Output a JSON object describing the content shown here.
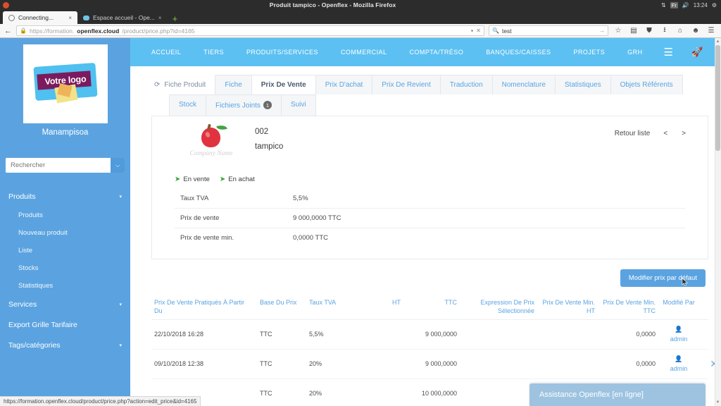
{
  "os": {
    "window_title": "Produit tampico - Openflex - Mozilla Firefox",
    "keyboard_layout": "Fr",
    "clock": "13:24",
    "network_icon": "network-icon",
    "volume_icon": "volume-icon",
    "settings_icon": "gear-icon"
  },
  "browser": {
    "tabs": [
      {
        "label": "Connecting...",
        "close": "×",
        "active": true
      },
      {
        "label": "Espace accueil - Ope...",
        "close": "×",
        "active": false
      }
    ],
    "new_tab": "+",
    "back_icon": "←",
    "url": {
      "scheme": "https://formation.",
      "host": "openflex.cloud",
      "path": "/product/price.php?id=4165",
      "lock_icon": "🔒"
    },
    "search": {
      "value": "test",
      "icon": "🔍",
      "go": "→"
    },
    "toolbar_icons": [
      "star-icon",
      "pocket-icon",
      "shield-icon",
      "download-icon",
      "home-icon",
      "account-icon",
      "menu-icon"
    ]
  },
  "sidebar": {
    "logo_text": "Votre logo",
    "company": "Manampisoa",
    "search_placeholder": "Rechercher",
    "dropdown_caret": "⌵",
    "groups": [
      {
        "label": "Produits",
        "caret": "▾",
        "type": "group"
      },
      {
        "label": "Produits",
        "type": "sub"
      },
      {
        "label": "Nouveau produit",
        "type": "sub"
      },
      {
        "label": "Liste",
        "type": "sub"
      },
      {
        "label": "Stocks",
        "type": "sub"
      },
      {
        "label": "Statistiques",
        "type": "sub"
      },
      {
        "label": "Services",
        "caret": "▾",
        "type": "group"
      },
      {
        "label": "Export Grille Tarifaire",
        "type": "item"
      },
      {
        "label": "Tags/catégories",
        "caret": "▾",
        "type": "group"
      }
    ]
  },
  "topnav": {
    "items": [
      "ACCUEIL",
      "TIERS",
      "PRODUITS/SERVICES",
      "COMMERCIAL",
      "COMPTA/TRÉSO",
      "BANQUES/CAISSES",
      "PROJETS",
      "GRH"
    ],
    "burger": "☰",
    "right_icons": [
      "rocket-icon",
      "user-icon",
      "printer-icon",
      "power-icon"
    ]
  },
  "product_tabs": {
    "fiche_produit": "Fiche Produit",
    "refresh_icon": "refresh-icon",
    "row1": [
      {
        "label": "Fiche",
        "active": false
      },
      {
        "label": "Prix De Vente",
        "active": true
      },
      {
        "label": "Prix D'achat",
        "active": false
      },
      {
        "label": "Prix De Revient",
        "active": false
      },
      {
        "label": "Traduction",
        "active": false
      },
      {
        "label": "Nomenclature",
        "active": false
      },
      {
        "label": "Statistiques",
        "active": false
      },
      {
        "label": "Objets Référents",
        "active": false
      }
    ],
    "row2": [
      {
        "label": "Stock",
        "active": false,
        "badge": ""
      },
      {
        "label": "Fichiers Joints",
        "active": false,
        "badge": "1"
      },
      {
        "label": "Suivi",
        "active": false,
        "badge": ""
      }
    ]
  },
  "product": {
    "code": "002",
    "name": "tampico",
    "logo_caption": "Company Name",
    "retour_liste": "Retour liste",
    "prev": "<",
    "next": ">",
    "flags": [
      {
        "label": "En vente",
        "icon": "check-flag-icon"
      },
      {
        "label": "En achat",
        "icon": "check-flag-icon"
      }
    ],
    "info_rows": [
      {
        "label": "Taux TVA",
        "value": "5,5%"
      },
      {
        "label": "Prix de vente",
        "value": "9 000,0000 TTC"
      },
      {
        "label": "Prix de vente min.",
        "value": "0,0000 TTC"
      }
    ]
  },
  "actions": {
    "modify_default_price": "Modifier prix par défaut"
  },
  "price_table": {
    "headers": [
      "Prix De Vente Pratiqués À Partir Du",
      "Base Du Prix",
      "Taux TVA",
      "HT",
      "TTC",
      "Expression De Prix Sélectionnée",
      "Prix De Vente Min. HT",
      "Prix De Vente Min. TTC",
      "Modifié Par"
    ],
    "rows": [
      {
        "date": "22/10/2018 16:28",
        "base": "TTC",
        "tva": "5,5%",
        "ht": "",
        "ttc": "9 000,0000",
        "expression": "",
        "min_ht": "",
        "min_ttc": "0,0000",
        "user": "admin",
        "delete": ""
      },
      {
        "date": "09/10/2018 12:38",
        "base": "TTC",
        "tva": "20%",
        "ht": "",
        "ttc": "9 000,0000",
        "expression": "",
        "min_ht": "",
        "min_ttc": "0,0000",
        "user": "admin",
        "delete": "✕"
      },
      {
        "date": "",
        "base": "TTC",
        "tva": "20%",
        "ht": "",
        "ttc": "10 000,0000",
        "expression": "",
        "min_ht": "",
        "min_ttc": "",
        "user": "",
        "delete": ""
      }
    ]
  },
  "assistance": {
    "label": "Assistance Openflex [en ligne]"
  },
  "statusbar": {
    "url": "https://formation.openflex.cloud/product/price.php?action=edit_price&id=4165"
  },
  "colors": {
    "brand_blue": "#5cc0f2",
    "sidebar_blue": "#5ba3e0",
    "link_blue": "#5ba3e0",
    "assist_blue": "#9dc3e0"
  }
}
